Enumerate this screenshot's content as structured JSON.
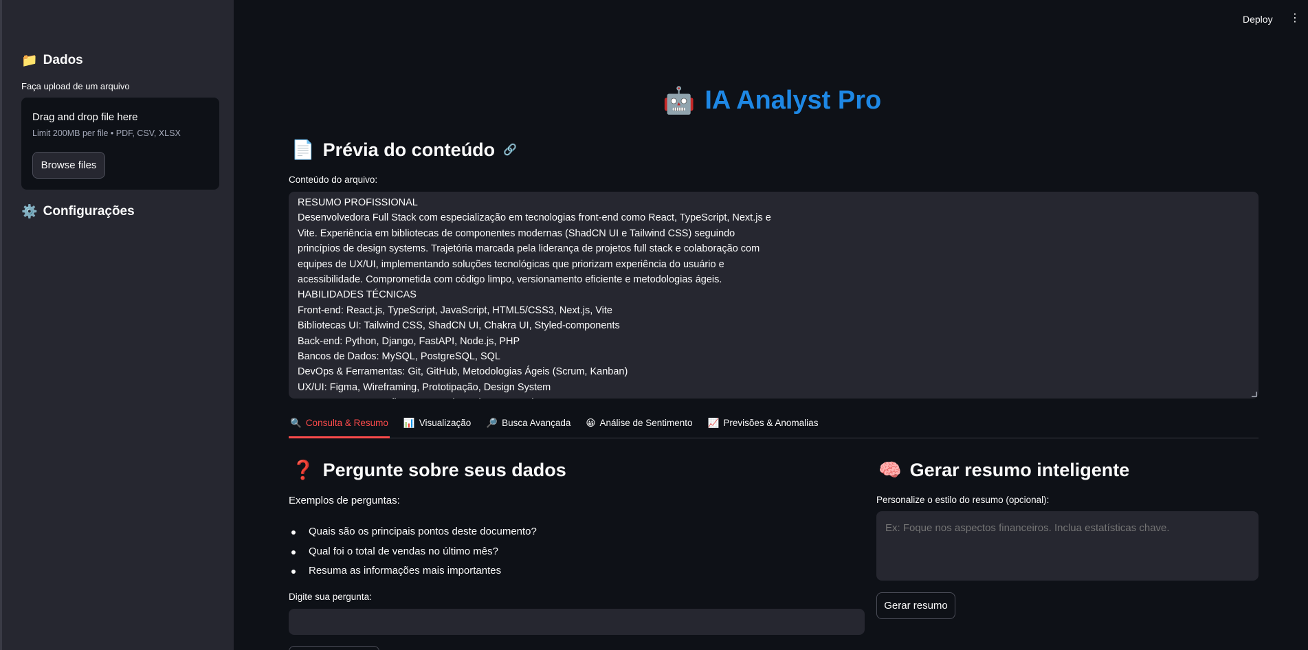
{
  "topbar": {
    "deploy_label": "Deploy",
    "menu_icon": "kebab-menu-icon"
  },
  "sidebar": {
    "data_header": {
      "icon": "📁",
      "label": "Dados"
    },
    "upload_label": "Faça upload de um arquivo",
    "dropzone": {
      "title": "Drag and drop file here",
      "limit": "Limit 200MB per file • PDF, CSV, XLSX",
      "browse_label": "Browse files"
    },
    "config_header": {
      "icon": "⚙️",
      "label": "Configurações"
    }
  },
  "app": {
    "title_icon": "🤖",
    "title": "IA Analyst Pro"
  },
  "preview": {
    "icon": "📄",
    "title": "Prévia do conteúdo",
    "link_icon": "🔗",
    "label": "Conteúdo do arquivo:",
    "lines": [
      "RESUMO PROFISSIONAL",
      "Desenvolvedora Full Stack com especialização em tecnologias front-end como React, TypeScript, Next.js e",
      "Vite. Experiência em bibliotecas de componentes modernas (ShadCN UI e Tailwind CSS) seguindo",
      "princípios de design systems. Trajetória marcada pela liderança de projetos full stack e colaboração com",
      "equipes de UX/UI, implementando soluções tecnológicas que priorizam experiência do usuário e",
      "acessibilidade. Comprometida com código limpo, versionamento eficiente e metodologias ágeis.",
      "HABILIDADES TÉCNICAS",
      "Front-end: React.js, TypeScript, JavaScript, HTML5/CSS3, Next.js, Vite",
      "Bibliotecas UI: Tailwind CSS, ShadCN UI, Chakra UI, Styled-components",
      "Back-end: Python, Django, FastAPI, Node.js, PHP",
      "Bancos de Dados: MySQL, PostgreSQL, SQL",
      "DevOps & Ferramentas: Git, GitHub, Metodologias Ágeis (Scrum, Kanban)",
      "UX/UI: Figma, Wireframing, Prototipação, Design System",
      "APIs: REST, Integrações externas (Google Maps API)"
    ]
  },
  "tabs": [
    {
      "icon": "🔍",
      "label": "Consulta & Resumo",
      "active": true
    },
    {
      "icon": "📊",
      "label": "Visualização",
      "active": false
    },
    {
      "icon": "🔎",
      "label": "Busca Avançada",
      "active": false
    },
    {
      "icon": "😀",
      "label": "Análise de Sentimento",
      "active": false
    },
    {
      "icon": "📈",
      "label": "Previsões & Anomalias",
      "active": false
    }
  ],
  "ask": {
    "icon": "❓",
    "title": "Pergunte sobre seus dados",
    "examples_label": "Exemplos de perguntas:",
    "examples": [
      "Quais são os principais pontos deste documento?",
      "Qual foi o total de vendas no último mês?",
      "Resuma as informações mais importantes"
    ],
    "input_label": "Digite sua pergunta:",
    "input_value": ""
  },
  "summary": {
    "icon": "🧠",
    "title": "Gerar resumo inteligente",
    "label": "Personalize o estilo do resumo (opcional):",
    "placeholder": "Ex: Foque nos aspectos financeiros. Inclua estatísticas chave.",
    "button_label": "Gerar resumo"
  },
  "colors": {
    "accent": "#ff4b4b",
    "title_blue": "#1e88e5",
    "background": "#0e1117",
    "sidebar": "#262730"
  }
}
